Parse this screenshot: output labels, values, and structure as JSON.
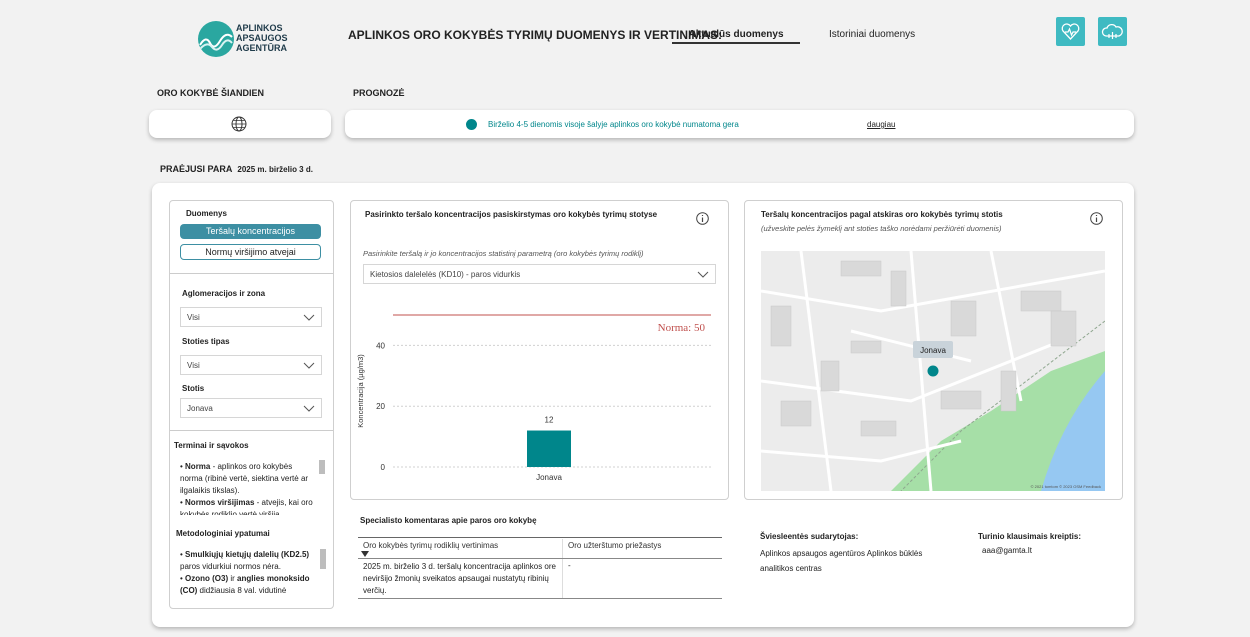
{
  "logo": {
    "line1": "APLINKOS",
    "line2": "APSAUGOS",
    "line3": "AGENTŪRA"
  },
  "header": {
    "title": "APLINKOS ORO KOKYBĖS TYRIMŲ DUOMENYS IR VERTINIMAS:",
    "tab_current": "Aktualūs duomenys",
    "tab_history": "Istoriniai duomenys",
    "icons": [
      "heart-pulse-icon",
      "cloud-data-icon"
    ],
    "accent_color": "#3fbac2"
  },
  "today": {
    "label": "ORO KOKYBĖ ŠIANDIEN",
    "icon": "globe-icon"
  },
  "forecast": {
    "label": "PROGNOZĖ",
    "text": "Birželio 4-5 dienomis visoje šalyje aplinkos oro kokybė numatoma gera",
    "more": "daugiau",
    "dot_color": "#00868b"
  },
  "past_day": {
    "label": "PRAĖJUSI PARA",
    "date": "2025 m. birželio 3 d."
  },
  "sidebar": {
    "data_label": "Duomenys",
    "btn_concentrations": "Teršalų koncentracijos",
    "btn_exceedances": "Normų viršijimo atvejai",
    "aglo_label": "Aglomeracijos ir zona",
    "aglo_value": "Visi",
    "station_type_label": "Stoties tipas",
    "station_type_value": "Visi",
    "station_label": "Stotis",
    "station_value": "Jonava",
    "terms_title": "Terminai ir sąvokos",
    "term1_bold": "Norma",
    "term1_text": " - aplinkos oro kokybės norma (ribinė vertė, siektina vertė ar ilgalaikis tikslas).",
    "term2_bold": "Normos viršijimas",
    "term2_text": " - atvejis, kai oro kokybės rodiklio vertė viršija",
    "method_title": "Metodologiniai ypatumai",
    "m1_bold": "Smulkiųjų kietųjų dalelių (KD2.5)",
    "m1_text": " paros vidurkiui normos nėra.",
    "m2_bold1": "Ozono (O3)",
    "m2_mid": " ir ",
    "m2_bold2": "anglies monoksido (CO)",
    "m2_text": " didžiausia 8 val. vidutinė"
  },
  "chart_panel": {
    "title": "Pasirinkto teršalo koncentracijos pasiskirstymas oro kokybės tyrimų stotyse",
    "hint": "Pasirinkite teršalą ir jo koncentracijos statistinį parametrą (oro kokybės tyrimų rodiklį)",
    "select_value": "Kietosios dalelelės (KD10) - paros vidurkis",
    "info_icon": "info-icon"
  },
  "chart_data": {
    "type": "bar",
    "categories": [
      "Jonava"
    ],
    "values": [
      12
    ],
    "data_labels": [
      "12"
    ],
    "ylabel": "Koncentracija (µg/m3)",
    "ylim": [
      0,
      50
    ],
    "yticks": [
      0,
      20,
      40
    ],
    "norm_value": 50,
    "norm_label": "Norma: 50",
    "bar_color": "#00868b",
    "norm_color": "#c0504d",
    "grid": true
  },
  "map_panel": {
    "title": "Teršalų koncentracijos pagal atskiras oro kokybės tyrimų stotis",
    "subtitle": "(užveskite pelės žymeklį ant stoties taško norėdami peržiūrėti duomenis)",
    "station_tooltip": "Jonava",
    "attribution": "© 2021 tomtom © 2023 OSM Feedback",
    "marker_color": "#00868b"
  },
  "comments": {
    "title": "Specialisto komentaras apie paros oro kokybę",
    "col1": "Oro kokybės tyrimų rodiklių vertinimas",
    "col2": "Oro užterštumo priežastys",
    "row1_c1": "2025 m. birželio 3 d. teršalų koncentracija aplinkos ore neviršijo žmonių sveikatos apsaugai nustatytų ribinių verčių.",
    "row1_c2": "-"
  },
  "footer": {
    "creator_label": "Šviesleentės sudarytojas:",
    "creator_value": "Aplinkos apsaugos agentūros Aplinkos būklės analitikos centras",
    "contact_label": "Turinio klausimais kreiptis:",
    "contact_value": "aaa@gamta.lt"
  }
}
